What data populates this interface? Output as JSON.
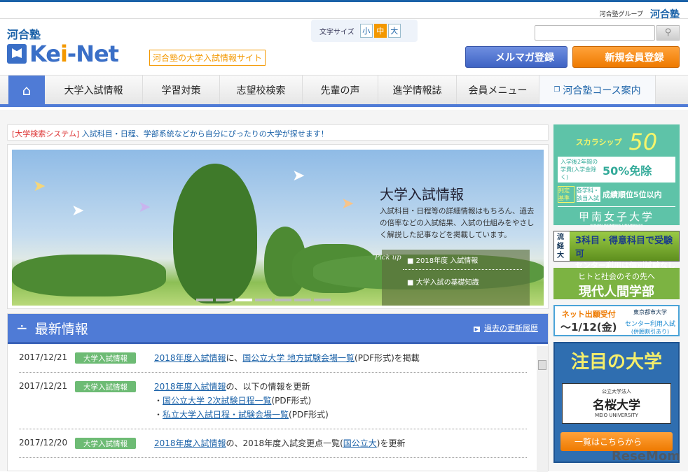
{
  "header": {
    "group_label": "河合塾グループ",
    "group_brand": "河合塾",
    "brand_small": "河合塾",
    "logo_text": "Kei-Net",
    "tagline": "河合塾の大学入試情報サイト",
    "font_size_label": "文字サイズ",
    "font_sizes": [
      "小",
      "中",
      "大"
    ],
    "selected_font_size": "中",
    "search_placeholder": "",
    "mail_button": "メルマガ登録",
    "register_button": "新規会員登録"
  },
  "nav": {
    "items": [
      "大学入試情報",
      "学習対策",
      "志望校検索",
      "先輩の声",
      "進学情報誌",
      "会員メニュー"
    ],
    "course": "河合塾コース案内"
  },
  "notice": {
    "tag": "[大学検索システム]",
    "text": "入試科目・日程、学部系統などから自分にぴったりの大学が探せます！"
  },
  "hero": {
    "title": "大学入試情報",
    "desc": "入試科目・日程等の詳細情報はもちろん、過去の倍率などの入試結果、入試の仕組みをやさしく解説した記事などを掲載しています。",
    "pickup_label": "Pick up",
    "pickup": [
      "2018年度 入試情報",
      "大学入試の基礎知識"
    ],
    "slide_count": 7,
    "active_slide": 3
  },
  "news": {
    "title": "最新情報",
    "history_link": "過去の更新履歴",
    "items": [
      {
        "date": "2017/12/21",
        "badge": "大学入試情報",
        "l1": "2018年度入試情報",
        "t1": "に、",
        "l2": "国公立大学 地方試験会場一覧",
        "t2": "(PDF形式)を掲載"
      },
      {
        "date": "2017/12/21",
        "badge": "大学入試情報",
        "l1": "2018年度入試情報",
        "t1": "の、以下の情報を更新",
        "s1": "国公立大学 2次試験日程一覧",
        "s1t": "(PDF形式)",
        "s2": "私立大学入試日程・試験会場一覧",
        "s2t": "(PDF形式)"
      },
      {
        "date": "2017/12/20",
        "badge": "大学入試情報",
        "l1": "2018年度入試情報",
        "t1": "の、2018年度入試変更点一覧(",
        "l2": "国公立大",
        "t2": ")を更新"
      }
    ]
  },
  "ads": {
    "konan": {
      "title": "スカラシップ",
      "num": "50",
      "l1": "入学後2年間の学費(入学金除く)",
      "v1": "50%免除",
      "l2": "判定基準",
      "l2b": "各学科・該当入試",
      "v2": "成績順位5位以内",
      "univ": "甲南女子大学",
      "univ_en": "KONAN WOMEN'S UNIVERSITY"
    },
    "ryutsu": {
      "mark": "流経大",
      "l1": "3科目・得意科目で受験可",
      "l2": "センター利用は個別試験なし"
    },
    "gendai": {
      "l1": "ヒトと社会のその先へ",
      "l2": "現代人間学部"
    },
    "toshi": {
      "l1": "ネット出願受付",
      "l2": "〜1/12(金)",
      "univ": "東京都市大学",
      "l3": "センター利用入試",
      "l4": "(併願割引あり)"
    },
    "chumoku": {
      "title": "注目の大学",
      "sub": "公立大学法人",
      "univ": "名桜大学",
      "univ_en": "MEIO UNIVERSITY",
      "button": "一覧はこちらから"
    }
  },
  "watermark": "ReseMom"
}
